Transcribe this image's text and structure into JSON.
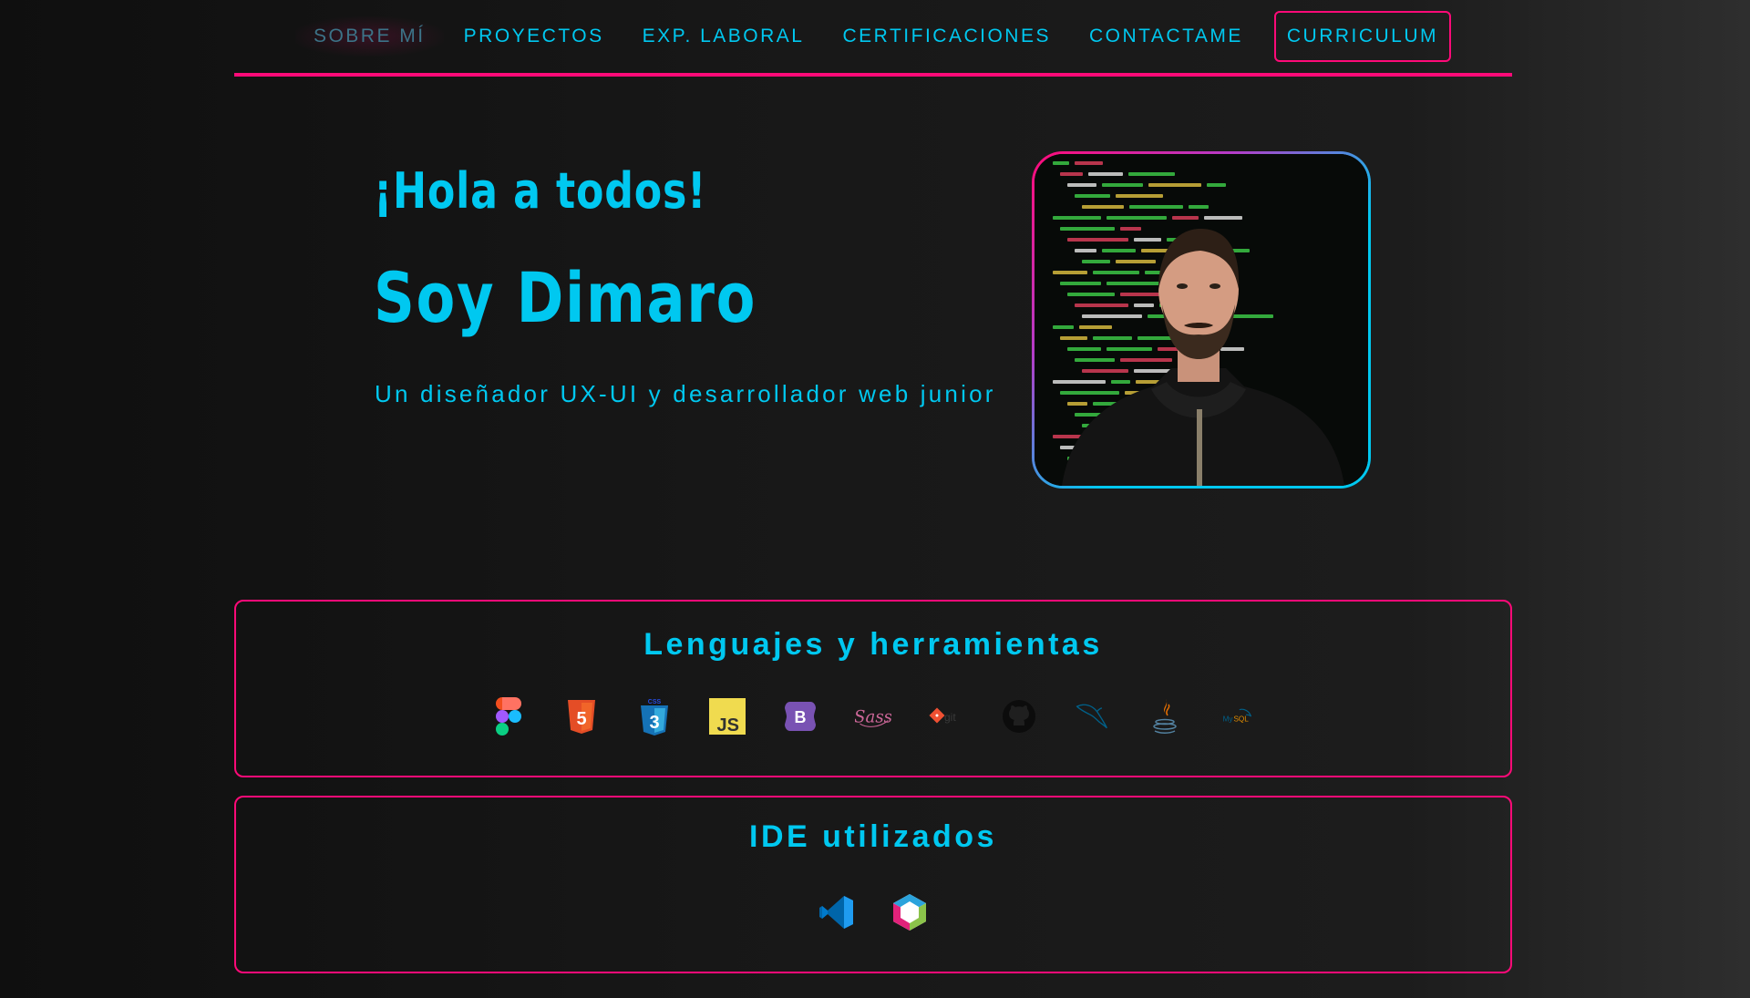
{
  "nav": {
    "items": [
      {
        "label": "SOBRE MÍ",
        "active": true
      },
      {
        "label": "PROYECTOS"
      },
      {
        "label": "EXP. LABORAL"
      },
      {
        "label": "CERTIFICACIONES"
      },
      {
        "label": "CONTACTAME"
      }
    ],
    "cv_label": "CURRICULUM"
  },
  "hero": {
    "greeting": "¡Hola a todos!",
    "name": "Soy Dimaro",
    "subtitle": "Un diseñador UX-UI y desarrollador web junior"
  },
  "portrait": {
    "icon": "profile-photo"
  },
  "skills": {
    "title": "Lenguajes y herramientas",
    "icons": [
      "figma-icon",
      "html5-icon",
      "css3-icon",
      "javascript-icon",
      "bootstrap-icon",
      "sass-icon",
      "git-icon",
      "github-icon",
      "mysql-dolphin-icon",
      "java-icon",
      "mysql-icon"
    ]
  },
  "ides": {
    "title": "IDE utilizados",
    "icons": [
      "vscode-icon",
      "netbeans-icon"
    ]
  },
  "colors": {
    "accent": "#ff0a78",
    "text": "#00c8f0",
    "background": "#161616"
  }
}
